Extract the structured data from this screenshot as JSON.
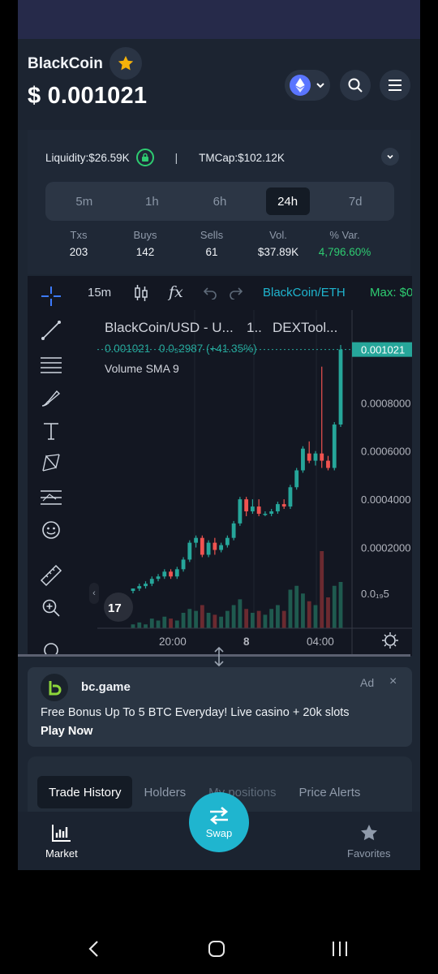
{
  "header": {
    "coin_name": "BlackCoin",
    "price": "$ 0.001021"
  },
  "stats": {
    "liquidity_label": "Liquidity:",
    "liquidity_value": "$26.59K",
    "separator": "|",
    "tmcap_label": "TMCap:",
    "tmcap_value": "$102.12K",
    "timeframes": [
      "5m",
      "1h",
      "6h",
      "24h",
      "7d"
    ],
    "active_timeframe": "24h",
    "metrics": [
      {
        "label": "Txs",
        "value": "203"
      },
      {
        "label": "Buys",
        "value": "142"
      },
      {
        "label": "Sells",
        "value": "61"
      },
      {
        "label": "Vol.",
        "value": "$37.89K"
      },
      {
        "label": "% Var.",
        "value": "4,796.60%"
      }
    ]
  },
  "chart_toolbar": {
    "interval": "15m",
    "pair": "BlackCoin/ETH",
    "max_label": "Max: $0"
  },
  "chart_data": {
    "type": "candlestick",
    "title": "BlackCoin/USD - U...",
    "interval_short": "1..",
    "source": "DEXTool...",
    "legend_price": "0.001021",
    "legend_change": "0.0₅2987 (+41.35%)",
    "indicator": "Volume SMA 9",
    "last_price_label": "0.001021",
    "y_ticks": [
      "0.0008000",
      "0.0006000",
      "0.0004000",
      "0.0002000",
      "0.0₁₉5"
    ],
    "x_ticks": [
      "20:00",
      "8",
      "04:00"
    ],
    "ylim": [
      0,
      0.00105
    ],
    "candles": [
      {
        "o": 2e-05,
        "h": 3e-05,
        "l": 1e-05,
        "c": 3e-05
      },
      {
        "o": 3e-05,
        "h": 5e-05,
        "l": 2e-05,
        "c": 4e-05
      },
      {
        "o": 4e-05,
        "h": 6e-05,
        "l": 3e-05,
        "c": 5e-05
      },
      {
        "o": 5e-05,
        "h": 8e-05,
        "l": 4e-05,
        "c": 7e-05
      },
      {
        "o": 7e-05,
        "h": 9e-05,
        "l": 6e-05,
        "c": 8e-05
      },
      {
        "o": 8e-05,
        "h": 0.00011,
        "l": 7e-05,
        "c": 0.0001
      },
      {
        "o": 0.0001,
        "h": 0.00011,
        "l": 7e-05,
        "c": 8e-05
      },
      {
        "o": 8e-05,
        "h": 0.00012,
        "l": 7e-05,
        "c": 0.00011
      },
      {
        "o": 0.00011,
        "h": 0.00016,
        "l": 0.0001,
        "c": 0.00015
      },
      {
        "o": 0.00015,
        "h": 0.00023,
        "l": 0.00014,
        "c": 0.00022
      },
      {
        "o": 0.00022,
        "h": 0.00025,
        "l": 0.0002,
        "c": 0.00024
      },
      {
        "o": 0.00024,
        "h": 0.00025,
        "l": 0.00016,
        "c": 0.00017
      },
      {
        "o": 0.00017,
        "h": 0.00023,
        "l": 0.00016,
        "c": 0.00022
      },
      {
        "o": 0.00022,
        "h": 0.00024,
        "l": 0.00017,
        "c": 0.00019
      },
      {
        "o": 0.00019,
        "h": 0.00022,
        "l": 0.00018,
        "c": 0.00021
      },
      {
        "o": 0.00021,
        "h": 0.00025,
        "l": 0.0002,
        "c": 0.00024
      },
      {
        "o": 0.00024,
        "h": 0.00031,
        "l": 0.00023,
        "c": 0.0003
      },
      {
        "o": 0.0003,
        "h": 0.00041,
        "l": 0.00029,
        "c": 0.0004
      },
      {
        "o": 0.0004,
        "h": 0.00041,
        "l": 0.00033,
        "c": 0.00035
      },
      {
        "o": 0.00035,
        "h": 0.0004,
        "l": 0.00034,
        "c": 0.00037
      },
      {
        "o": 0.00037,
        "h": 0.0004,
        "l": 0.00033,
        "c": 0.00034
      },
      {
        "o": 0.00034,
        "h": 0.00035,
        "l": 0.00033,
        "c": 0.00034
      },
      {
        "o": 0.00034,
        "h": 0.00036,
        "l": 0.00033,
        "c": 0.00035
      },
      {
        "o": 0.00035,
        "h": 0.00039,
        "l": 0.00034,
        "c": 0.00038
      },
      {
        "o": 0.00038,
        "h": 0.0004,
        "l": 0.00036,
        "c": 0.00037
      },
      {
        "o": 0.00037,
        "h": 0.00046,
        "l": 0.00036,
        "c": 0.00045
      },
      {
        "o": 0.00045,
        "h": 0.00053,
        "l": 0.00044,
        "c": 0.00052
      },
      {
        "o": 0.00052,
        "h": 0.00062,
        "l": 0.00051,
        "c": 0.00061
      },
      {
        "o": 0.00059,
        "h": 0.00064,
        "l": 0.00055,
        "c": 0.00056
      },
      {
        "o": 0.00056,
        "h": 0.0006,
        "l": 0.00054,
        "c": 0.00059
      },
      {
        "o": 0.00059,
        "h": 0.00095,
        "l": 0.00053,
        "c": 0.00056
      },
      {
        "o": 0.00056,
        "h": 0.00058,
        "l": 0.00052,
        "c": 0.00053
      },
      {
        "o": 0.00053,
        "h": 0.00072,
        "l": 0.00052,
        "c": 0.00071
      },
      {
        "o": 0.00071,
        "h": 0.00104,
        "l": 0.0007,
        "c": 0.001021
      }
    ],
    "volumes": [
      2,
      3,
      2,
      5,
      4,
      6,
      5,
      4,
      8,
      10,
      9,
      12,
      8,
      7,
      6,
      9,
      12,
      15,
      10,
      8,
      9,
      7,
      10,
      12,
      9,
      20,
      22,
      18,
      14,
      12,
      40,
      16,
      22,
      24
    ]
  },
  "ad": {
    "brand": "bc.game",
    "tag": "Ad",
    "close": "×",
    "text": "Free Bonus Up To 5 BTC Everyday! Live casino + 20k slots",
    "cta": "Play Now"
  },
  "tabs": [
    "Trade History",
    "Holders",
    "My positions",
    "Price Alerts"
  ],
  "bottom_nav": {
    "market": "Market",
    "swap": "Swap",
    "favorites": "Favorites"
  },
  "colors": {
    "up": "#26a69a",
    "down": "#ef5350",
    "accent": "#1fb5cf",
    "green": "#2ecc71"
  }
}
